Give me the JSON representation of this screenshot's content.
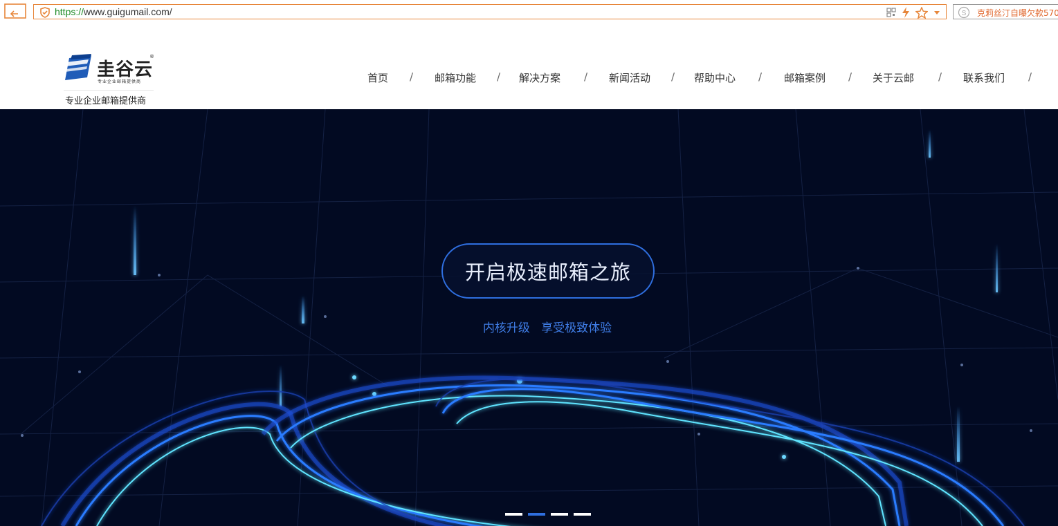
{
  "browser": {
    "url_scheme": "https://",
    "url_rest": "www.guigumail.com/",
    "search_suggestion": "克莉丝汀自曝欠款570"
  },
  "header": {
    "logo_name": "圭谷云",
    "logo_reg": "®",
    "logo_small": "专业企业邮箱提供商",
    "tagline": "专业企业邮箱提供商"
  },
  "nav": {
    "items": [
      "首页",
      "邮箱功能",
      "解决方案",
      "新闻活动",
      "帮助中心",
      "邮箱案例",
      "关于云邮",
      "联系我们"
    ],
    "separator": "/"
  },
  "hero": {
    "title": "开启极速邮箱之旅",
    "subtitle": "内核升级   享受极致体验",
    "slide_count": 4,
    "active_slide_index": 1
  },
  "colors": {
    "accent": "#2f6fe0",
    "hero_background": "#020a22",
    "address_border": "#e7863a",
    "url_scheme": "#1c8a24"
  }
}
